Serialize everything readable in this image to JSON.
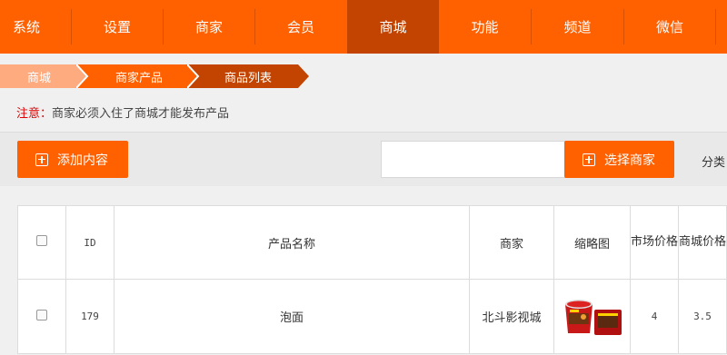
{
  "nav": {
    "items": [
      {
        "label": "系统"
      },
      {
        "label": "设置"
      },
      {
        "label": "商家"
      },
      {
        "label": "会员"
      },
      {
        "label": "商城"
      },
      {
        "label": "功能"
      },
      {
        "label": "频道"
      },
      {
        "label": "微信"
      }
    ],
    "active_index": 4
  },
  "breadcrumb": [
    "商城",
    "商家产品",
    "商品列表"
  ],
  "notice": {
    "label": "注意：",
    "text": "商家必须入住了商城才能发布产品"
  },
  "toolbar": {
    "add_label": "添加内容",
    "search_value": "",
    "select_merchant_label": "选择商家",
    "category_label": "分类"
  },
  "table": {
    "headers": {
      "id": "ID",
      "name": "产品名称",
      "merchant": "商家",
      "thumbnail": "缩略图",
      "market_price": "市场价格",
      "mall_price": "商城价格"
    },
    "rows": [
      {
        "id": "179",
        "name": "泡面",
        "merchant": "北斗影视城",
        "market_price": "4",
        "mall_price": "3.5"
      }
    ]
  },
  "colors": {
    "brand": "#ff6000",
    "nav_active": "#c24400",
    "notice_label": "#e00000"
  }
}
